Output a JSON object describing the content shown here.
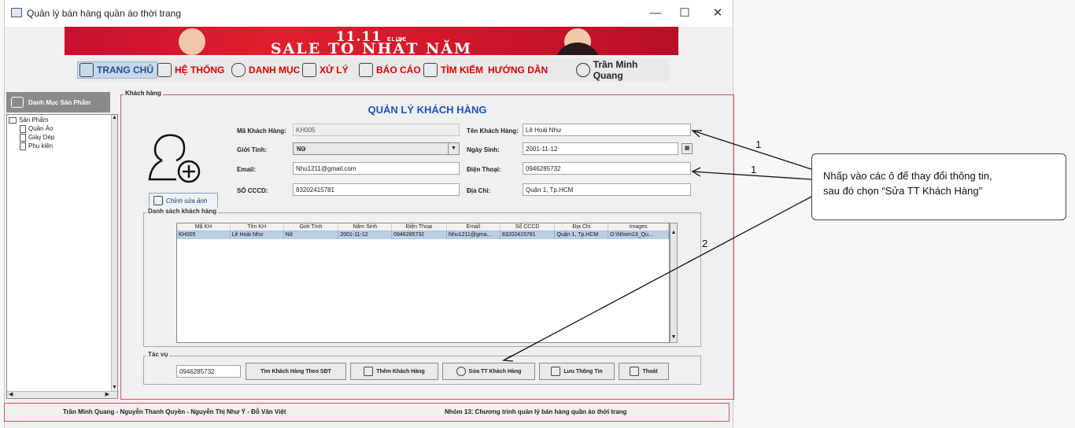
{
  "window": {
    "title": "Quản lý bán hàng quần áo thời trang",
    "controls": [
      "—",
      "☐",
      "✕"
    ]
  },
  "banner": {
    "line1": "11.11",
    "brand": "ELISE",
    "line2": "SALE TO NHẤT NĂM"
  },
  "menu": {
    "items": [
      "TRANG CHỦ",
      "HỆ THỐNG",
      "DANH MỤC",
      "XỬ LÝ",
      "BÁO CÁO",
      "TÌM KIẾM",
      "HƯỚNG DẪN"
    ],
    "user": "Trần Minh Quang"
  },
  "sidebar": {
    "header": "Danh Mục Sản Phẩm",
    "root": "Sản Phẩm",
    "children": [
      "Quần Áo",
      "Giày Dép",
      "Phụ kiện"
    ]
  },
  "panel": {
    "legend": "Khách hàng",
    "title": "QUẢN LÝ KHÁCH HÀNG"
  },
  "form": {
    "ma_label": "Mã Khách Hàng:",
    "ma_value": "KH005",
    "ten_label": "Tên Khách Hàng:",
    "ten_value": "Lê Hoài Như",
    "gioitinh_label": "Giới Tính:",
    "gioitinh_value": "Nữ",
    "ngaysinh_label": "Ngày Sinh:",
    "ngaysinh_value": "2001-11-12",
    "email_label": "Email:",
    "email_value": "Nhu1211@gmail.com",
    "dienthoai_label": "Điện Thoại:",
    "dienthoai_value": "0946285732",
    "cccd_label": "SỐ CCCD:",
    "cccd_value": "83202415781",
    "diachi_label": "Địa Chỉ:",
    "diachi_value": "Quận 1, Tp.HCM",
    "edit_photo": "Chỉnh sửa ảnh"
  },
  "list": {
    "legend": "Danh sách khách hàng",
    "columns": [
      "Mã KH",
      "Tên KH",
      "Giới Tính",
      "Năm Sinh",
      "Điện Thoại",
      "Email",
      "Số CCCD",
      "Địa Chỉ",
      "Images"
    ],
    "rows": [
      [
        "KH005",
        "Lê Hoài Như",
        "Nữ",
        "2001-11-12",
        "0946285732",
        "Nhu1211@gma...",
        "83202415781",
        "Quận 1, Tp.HCM",
        "D:\\Nhom13_Qu..."
      ]
    ]
  },
  "actions": {
    "legend": "Tác vụ",
    "search_value": "0946285732",
    "search_btn": "Tìm Khách Hàng Theo SĐT",
    "add_btn": "Thêm Khách Hàng",
    "edit_btn": "Sửa TT Khách Hàng",
    "save_btn": "Lưu Thông Tin",
    "exit_btn": "Thoát"
  },
  "footer": {
    "authors": "Trần Minh Quang - Nguyễn Thanh Quyền - Nguyễn Thị Như Ý - Đỗ Văn Việt",
    "project": "Nhóm 13: Chương trình quản lý bán hàng quần áo thời trang"
  },
  "annotation": {
    "callout_line1": "Nhấp vào các ô để thay đổi thông tin,",
    "callout_line2": "sau đó chọn “Sửa TT Khách Hàng”",
    "num1a": "1",
    "num1b": "1",
    "num2": "2"
  }
}
